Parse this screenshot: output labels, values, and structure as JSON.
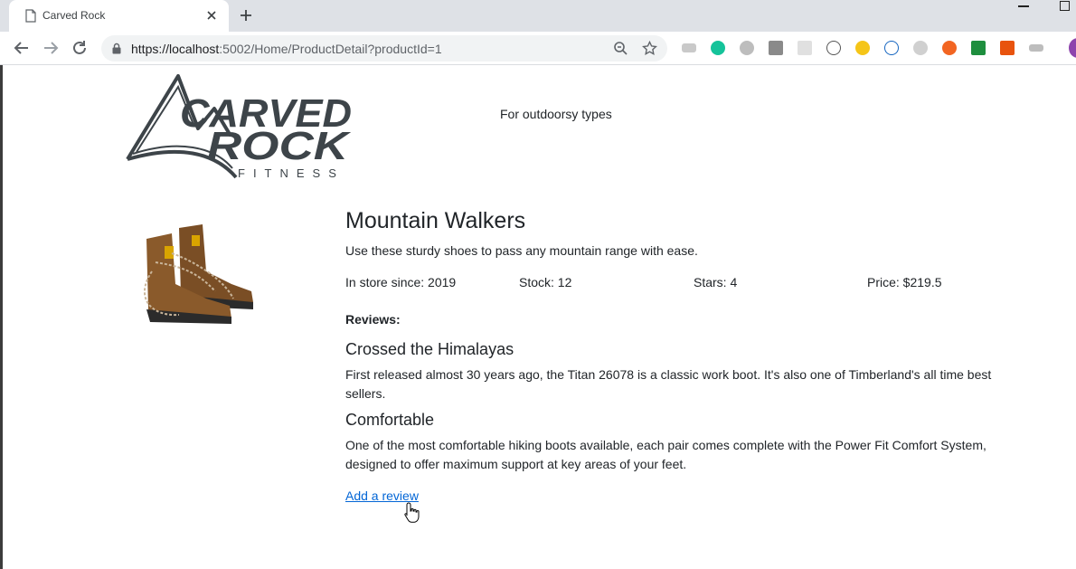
{
  "browser": {
    "tab_title": "Carved Rock",
    "url_host": "https://localhost",
    "url_rest": ":5002/Home/ProductDetail?productId=1"
  },
  "site": {
    "logo_text": [
      "CARVED",
      "ROCK",
      "FITNESS"
    ],
    "tagline": "For outdoorsy types"
  },
  "product": {
    "name": "Mountain Walkers",
    "description": "Use these sturdy shoes to pass any mountain range with ease.",
    "in_store": "In store since: 2019",
    "stock": "Stock: 12",
    "stars": "Stars: 4",
    "price": "Price: $219.5"
  },
  "reviews": {
    "label": "Reviews:",
    "items": [
      {
        "title": "Crossed the Himalayas",
        "body": "First released almost 30 years ago, the Titan 26078 is a classic work boot. It's also one of Timberland's all time best sellers."
      },
      {
        "title": "Comfortable",
        "body": "One of the most comfortable hiking boots available, each pair comes complete with the Power Fit Comfort System, designed to offer maximum support at key areas of your feet."
      }
    ],
    "add_link": "Add a review"
  },
  "colors": {
    "link": "#0366d6",
    "logo": "#3d4449"
  }
}
